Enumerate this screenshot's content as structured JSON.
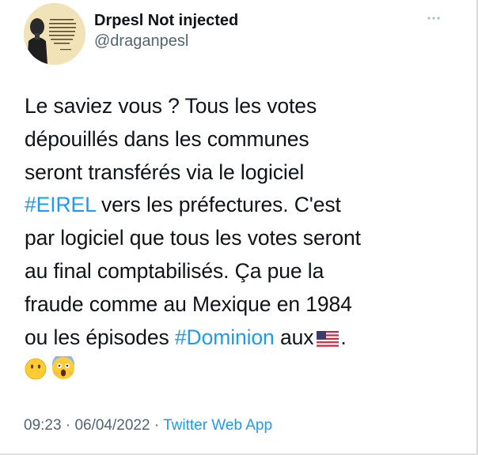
{
  "author": {
    "display_name": "Drpesl Not injected",
    "handle": "@draganpesl",
    "avatar_quote": "Parler de liberté n'a de sens qu'à condition que ce soit la liberté de dire aux autres ce qu'ils n'ont pas envie d'entendre.",
    "avatar_credit": "GEORGE ORWELL",
    "avatar_icon": "profile-portrait-icon"
  },
  "menu": {
    "icon": "more-dots-icon"
  },
  "tweet": {
    "line1": "Le saviez vous ? Tous les votes",
    "line2": "dépouillés dans les communes",
    "line3": "seront transférés via le logiciel",
    "hashtag1": "#EIREL",
    "line4_rest": " vers les préfectures. C'est",
    "line5": "par logiciel que tous les votes seront",
    "line6": "au final comptabilisés. Ça pue la",
    "line7": "fraude comme au Mexique en 1984",
    "line8_start": "ou les épisodes ",
    "hashtag2": "#Dominion",
    "line8_mid": " aux",
    "line8_end": ".",
    "flag_icon": "us-flag-icon",
    "emoji1_icon": "face-without-mouth-icon",
    "emoji2_icon": "face-screaming-icon"
  },
  "meta": {
    "time": "09:23",
    "sep1": " · ",
    "date": "06/04/2022",
    "sep2": " · ",
    "source": "Twitter Web App"
  },
  "colors": {
    "link": "#1d9bf0",
    "secondary": "#536471",
    "text": "#0f1419"
  }
}
